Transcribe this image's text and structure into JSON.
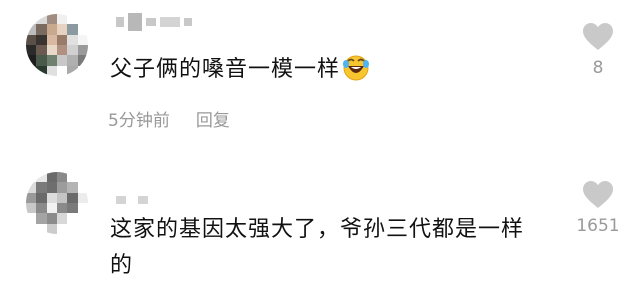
{
  "comments": [
    {
      "text": "父子俩的嗓音一模一样",
      "emoji": "laughing-crying-emoji",
      "time": "5分钟前",
      "reply_label": "回复",
      "likes": "8"
    },
    {
      "text": "这家的基因太强大了，爷孙三代都是一样的",
      "likes": "1651"
    }
  ],
  "icons": {
    "like": "heart-icon"
  },
  "colors": {
    "text": "#111111",
    "meta": "#999999",
    "heart": "#c9c9c9"
  }
}
